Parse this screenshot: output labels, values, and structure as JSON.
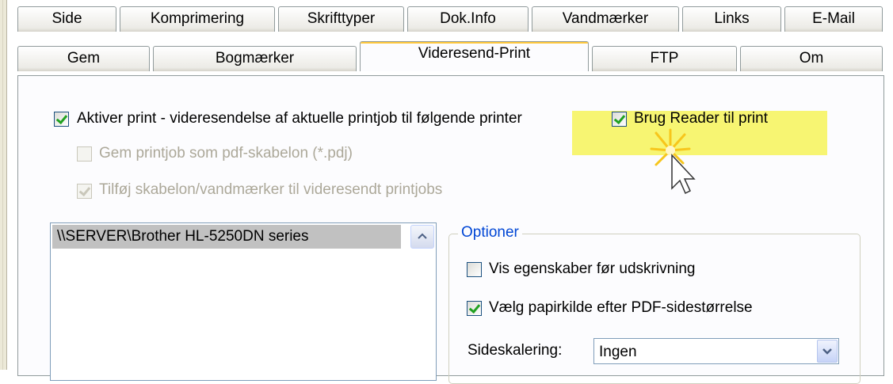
{
  "tabs": {
    "row_back": [
      "Side",
      "Komprimering",
      "Skrifttyper",
      "Dok.Info",
      "Vandmærker",
      "Links",
      "E-Mail"
    ],
    "row_front": [
      "Gem",
      "Bogmærker",
      "Videresend-Print",
      "FTP",
      "Om"
    ],
    "active": "Videresend-Print"
  },
  "options": {
    "activate_forward_print": {
      "label": "Aktiver print - videresendelse af aktuelle printjob til følgende printer",
      "checked": true
    },
    "use_reader": {
      "label": "Brug Reader til print",
      "checked": true
    },
    "save_as_template": {
      "label": "Gem printjob som pdf-skabelon (*.pdj)",
      "checked": false,
      "disabled": true
    },
    "add_template_watermarks": {
      "label": "Tilføj skabelon/vandmærker til videresendt printjobs",
      "checked": true,
      "disabled": true
    }
  },
  "printer_list": {
    "items": [
      "\\\\SERVER\\Brother HL-5250DN series"
    ],
    "selected_index": 0
  },
  "optioner": {
    "title": "Optioner",
    "show_properties": {
      "label": "Vis egenskaber før udskrivning",
      "checked": false
    },
    "paper_source": {
      "label": "Vælg papirkilde efter PDF-sidestørrelse",
      "checked": true
    },
    "scaling": {
      "label": "Sideskalering:",
      "value": "Ingen"
    }
  },
  "colors": {
    "highlight": "#f7f572",
    "active_tab_accent": "#ffc83c",
    "group_title": "#0046d5"
  }
}
